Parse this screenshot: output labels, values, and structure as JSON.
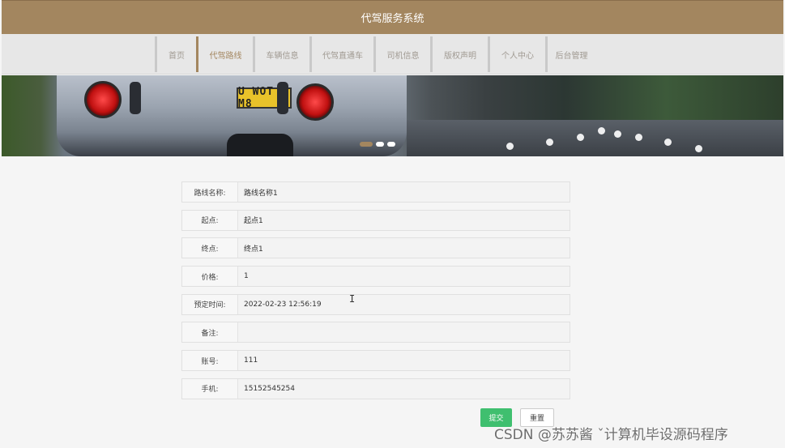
{
  "app": {
    "title": "代驾服务系统"
  },
  "nav": {
    "items": [
      {
        "label": "首页",
        "active": false
      },
      {
        "label": "代驾路线",
        "active": true
      },
      {
        "label": "车辆信息",
        "active": false
      },
      {
        "label": "代驾直通车",
        "active": false
      },
      {
        "label": "司机信息",
        "active": false
      },
      {
        "label": "版权声明",
        "active": false
      },
      {
        "label": "个人中心",
        "active": false
      },
      {
        "label": "后台管理",
        "active": false
      }
    ]
  },
  "banner": {
    "plate_text": "U WOT M8",
    "slides": 3,
    "active_slide": 0
  },
  "form": {
    "fields": [
      {
        "label": "路线名称:",
        "value": "路线名称1"
      },
      {
        "label": "起点:",
        "value": "起点1"
      },
      {
        "label": "终点:",
        "value": "终点1"
      },
      {
        "label": "价格:",
        "value": "1"
      },
      {
        "label": "预定时间:",
        "value": "2022-02-23 12:56:19"
      },
      {
        "label": "备注:",
        "value": ""
      },
      {
        "label": "账号:",
        "value": "111"
      },
      {
        "label": "手机:",
        "value": "15152545254"
      }
    ],
    "submit_label": "提交",
    "reset_label": "重置"
  },
  "watermark": "CSDN @苏苏酱    ˇ计算机毕设源码程序",
  "colors": {
    "header": "#a3865f",
    "accent": "#a3865f",
    "submit": "#3fbf6f"
  }
}
